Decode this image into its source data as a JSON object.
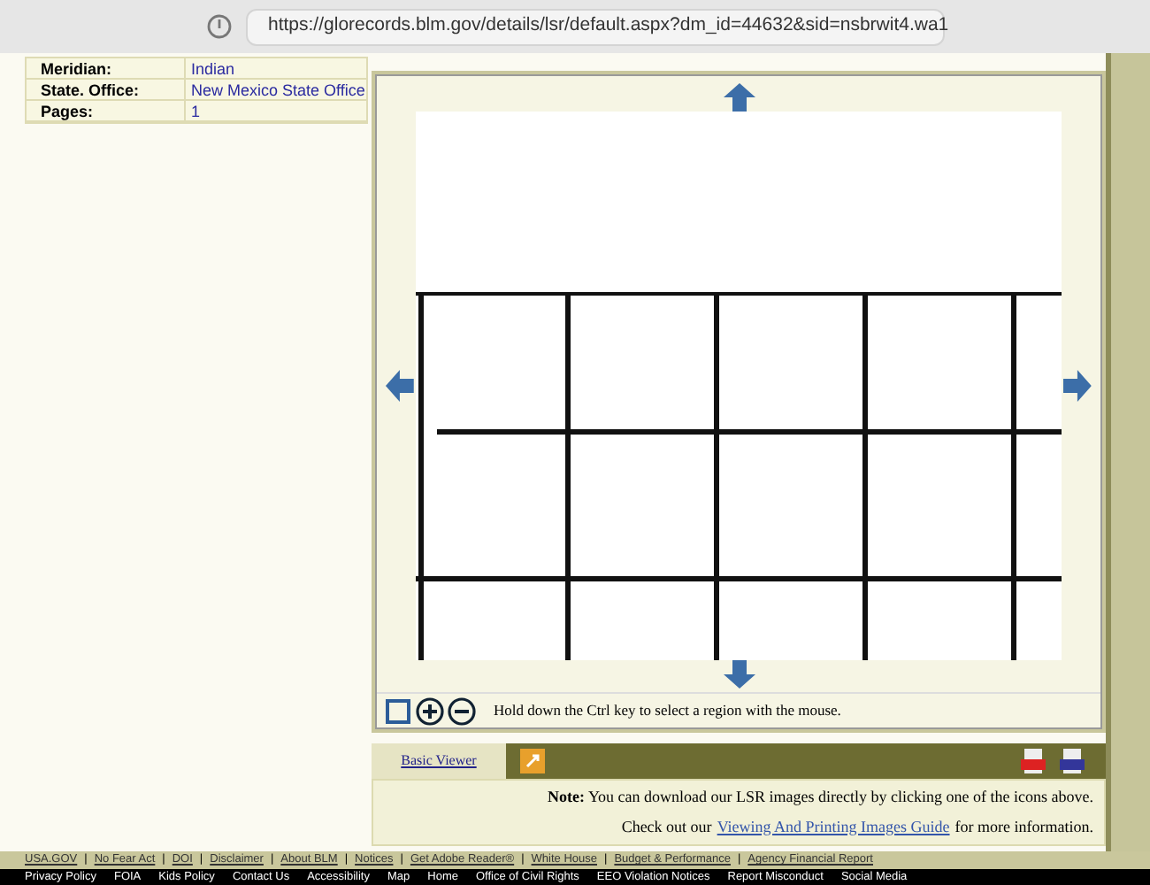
{
  "browser": {
    "url": "https://glorecords.blm.gov/details/lsr/default.aspx?dm_id=44632&sid=nsbrwit4.wa1"
  },
  "details": [
    {
      "label": "Meridian:",
      "value": "Indian"
    },
    {
      "label": "State. Office:",
      "value": "New Mexico State Office"
    },
    {
      "label": "Pages:",
      "value": "1"
    }
  ],
  "viewer": {
    "hint": "Hold down the Ctrl key to select a region with the mouse.",
    "tabs": [
      {
        "label": "Basic Viewer",
        "selected": true
      }
    ]
  },
  "note": {
    "text": "**Note:** You can download our LSR images directly by clicking one of the icons above.",
    "guide_prefix": "Check out our",
    "guide_link": "Viewing And Printing Images Guide",
    "guide_suffix": "for more information."
  },
  "footer_separator": "|",
  "footer_links": [
    "USA.GOV",
    "No Fear Act",
    "DOI",
    "Disclaimer",
    "About BLM",
    "Notices",
    "Get Adobe Reader®",
    "White House",
    "Budget & Performance",
    "Agency Financial Report"
  ],
  "bottom_links": [
    "Privacy Policy",
    "FOIA",
    "Kids Policy",
    "Contact Us",
    "Accessibility",
    "Map",
    "Home",
    "Office of Civil Rights",
    "EEO Violation Notices",
    "Report Misconduct",
    "Social Media"
  ]
}
